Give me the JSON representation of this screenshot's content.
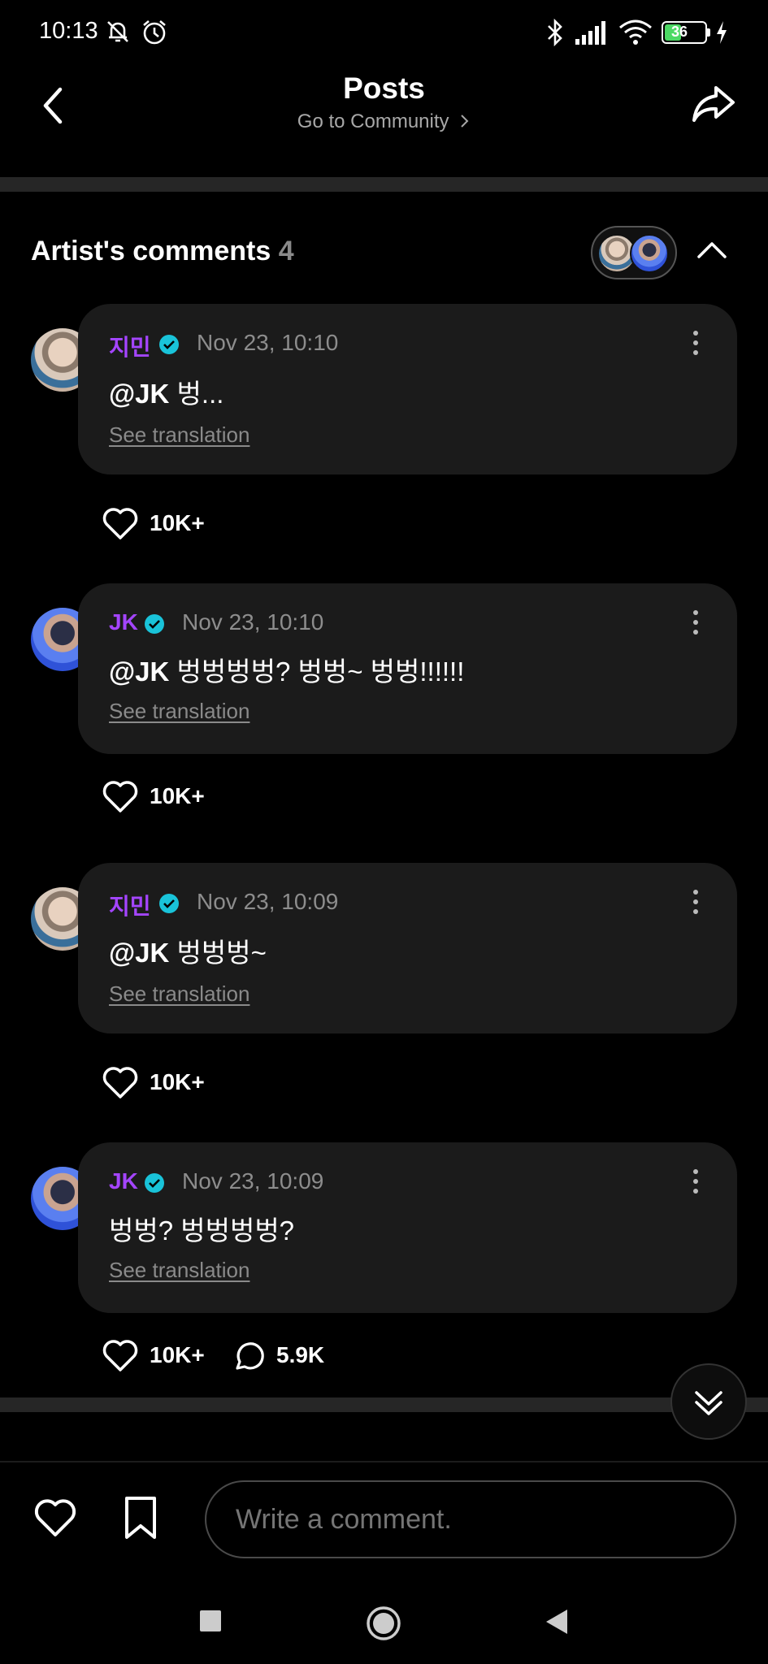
{
  "status_bar": {
    "time": "10:13",
    "battery": "36",
    "icons": [
      "mute-icon",
      "alarm-icon",
      "bluetooth-icon",
      "signal-icon",
      "wifi-icon",
      "battery-icon",
      "charging-icon"
    ]
  },
  "header": {
    "title": "Posts",
    "subtitle": "Go to Community",
    "back_icon": "chevron-left-icon",
    "share_icon": "share-icon"
  },
  "artist_comments": {
    "title": "Artist's comments",
    "count": "4",
    "collapse_icon": "chevron-up-icon"
  },
  "comments": [
    {
      "author": "지민",
      "time": "Nov 23, 10:10",
      "mention": "@JK",
      "text": " 벙...",
      "translate": "See translation",
      "likes": "10K+",
      "avatar": "jimin"
    },
    {
      "author": "JK",
      "time": "Nov 23, 10:10",
      "mention": "@JK",
      "text": " 벙벙벙벙? 벙벙~ 벙벙!!!!!!",
      "translate": "See translation",
      "likes": "10K+",
      "avatar": "jk"
    },
    {
      "author": "지민",
      "time": "Nov 23, 10:09",
      "mention": "@JK",
      "text": " 벙벙벙~",
      "translate": "See translation",
      "likes": "10K+",
      "avatar": "jimin"
    },
    {
      "author": "JK",
      "time": "Nov 23, 10:09",
      "mention": "",
      "text": "벙벙? 벙벙벙벙?",
      "translate": "See translation",
      "likes": "10K+",
      "replies": "5.9K",
      "avatar": "jk"
    }
  ],
  "bottom_bar": {
    "comment_placeholder": "Write a comment."
  },
  "colors": {
    "background": "#000000",
    "bubble": "#1b1b1b",
    "author": "#a445ff",
    "verified": "#19c3d9",
    "muted": "#8d8d8d"
  }
}
